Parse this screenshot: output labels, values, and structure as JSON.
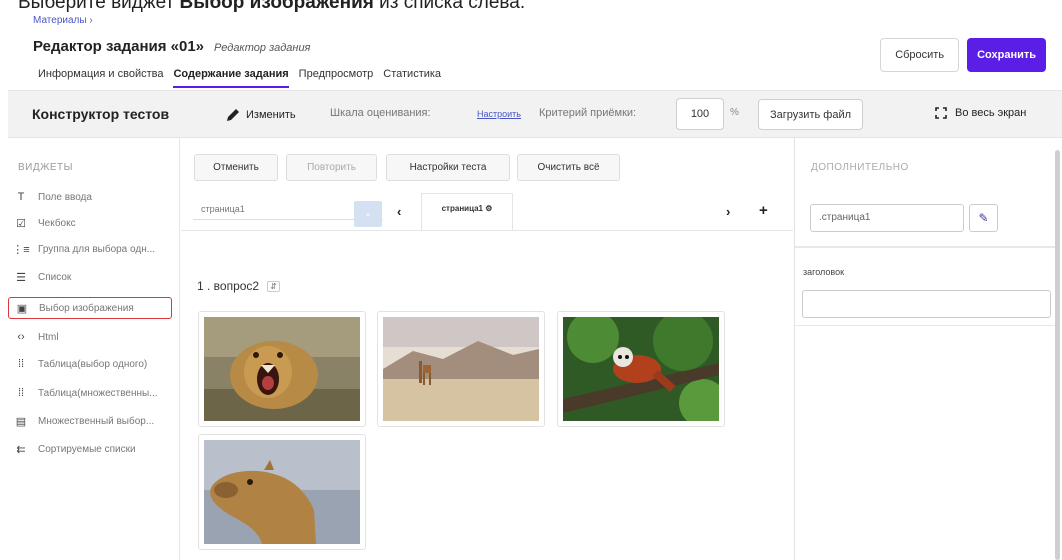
{
  "instruction": {
    "prefix": "Выберите виджет ",
    "bold": "Выбор изображения",
    "suffix": " из списка слева."
  },
  "header": {
    "breadcrumb": "Материалы ›",
    "title": "Редактор задания «01»",
    "subtitle": "Редактор задания",
    "reset_label": "Сбросить",
    "save_label": "Сохранить",
    "tabs": [
      {
        "label": "Информация и свойства",
        "active": false
      },
      {
        "label": "Содержание задания",
        "active": true
      },
      {
        "label": "Предпросмотр",
        "active": false
      },
      {
        "label": "Статистика",
        "active": false
      }
    ]
  },
  "toolbar": {
    "title": "Конструктор тестов",
    "edit_label": "Изменить",
    "scale_label": "Шкала оценивания:",
    "configure_label": "Настроить",
    "criterion_label": "Критерий приёмки:",
    "criterion_value": "100",
    "percent": "%",
    "upload_label": "Загрузить файл",
    "fullscreen_label": "Во весь экран"
  },
  "sidebar": {
    "heading": "ВИДЖЕТЫ",
    "items": [
      {
        "icon": "text-icon",
        "glyph": "T",
        "label": "Поле ввода"
      },
      {
        "icon": "checkbox-icon",
        "glyph": "☑",
        "label": "Чекбокс"
      },
      {
        "icon": "radio-list-icon",
        "glyph": "⋮≡",
        "label": "Группа для выбора одн..."
      },
      {
        "icon": "list-icon",
        "glyph": "☰",
        "label": "Список"
      },
      {
        "icon": "image-icon",
        "glyph": "▣",
        "label": "Выбор изображения"
      },
      {
        "icon": "code-icon",
        "glyph": "‹›",
        "label": "Html"
      },
      {
        "icon": "table-single-icon",
        "glyph": "⁞⁞",
        "label": "Таблица(выбор одного)"
      },
      {
        "icon": "table-multi-icon",
        "glyph": "⁞⁞",
        "label": "Таблица(множественны..."
      },
      {
        "icon": "multi-select-icon",
        "glyph": "▤",
        "label": "Множественный выбор..."
      },
      {
        "icon": "sortable-icon",
        "glyph": "⇇",
        "label": "Сортируемые списки"
      }
    ]
  },
  "center": {
    "undo_label": "Отменить",
    "redo_label": "Повторить",
    "settings_label": "Настройки теста",
    "clear_label": "Очистить всё",
    "page_select": "страница1",
    "page_tab": "страница1 ⚙",
    "question_label": "1 .  вопрос2",
    "images": [
      {
        "name": "lion-image"
      },
      {
        "name": "giraffe-image"
      },
      {
        "name": "red-panda-image"
      },
      {
        "name": "camel-image"
      }
    ]
  },
  "right_panel": {
    "heading": "ДОПОЛНИТЕЛЬНО",
    "page_name": ".страница1",
    "title_label": "заголовок",
    "title_value": ""
  },
  "colors": {
    "accent": "#5b1ee6",
    "highlight": "#d9383f",
    "link": "#4a56c6"
  }
}
